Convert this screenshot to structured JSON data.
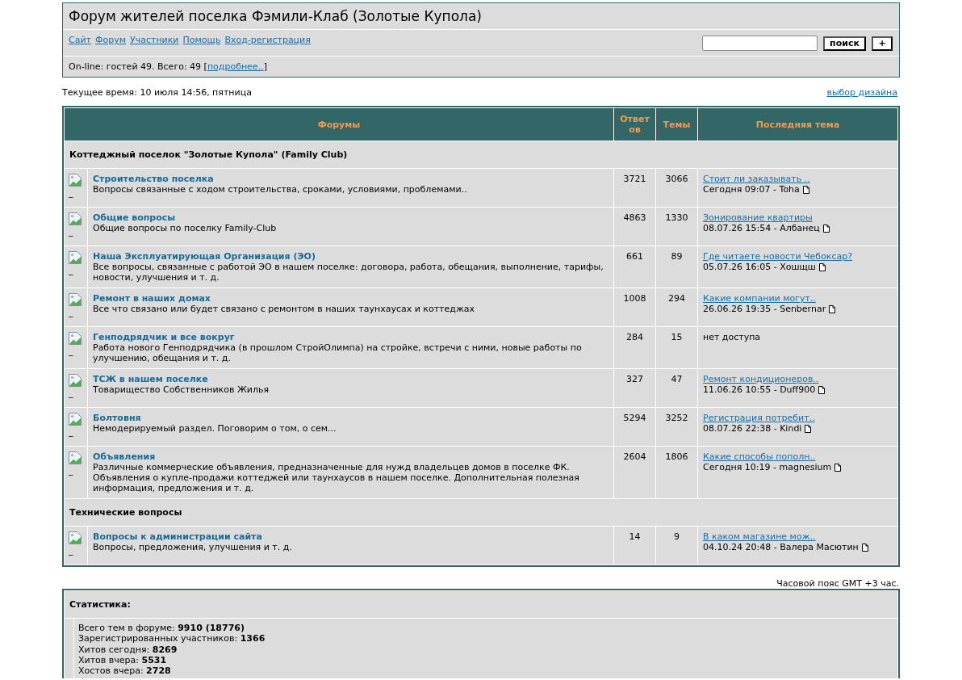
{
  "header": {
    "title": "Форум жителей поселка Фэмили-Клаб (Золотые Купола)",
    "nav_links": [
      "Сайт",
      "Форум",
      "Участники",
      "Помощь",
      "Вход-регистрация"
    ],
    "search": {
      "button": "поиск",
      "add_button": "+"
    },
    "online": {
      "text": "On-line: гостей 49. Всего: 49 [",
      "link": "подробнее..",
      "suffix": "]"
    }
  },
  "current_time": "Текущее время: 10 июля 14:56, пятница",
  "design_link": "выбор дизайна",
  "forum_table": {
    "columns": [
      "Форумы",
      "Ответов",
      "Темы",
      "Последняя тема"
    ],
    "sections": [
      {
        "title": "Коттеджный поселок \"Золотые Купола\" (Family Club)",
        "forums": [
          {
            "icon_alt": "_",
            "name": "Строительство поселка",
            "description": "Вопросы связанные с ходом строительства, сроками, условиями, проблемами..",
            "replies": "3721",
            "topics": "3066",
            "last_post": {
              "kind": "post",
              "topic": "Стоит ли заказывать ..",
              "meta": "Сегодня 09:07 - Toha"
            }
          },
          {
            "icon_alt": "_",
            "name": "Общие вопросы",
            "description": "Общие вопросы по поселку Family-Club",
            "replies": "4863",
            "topics": "1330",
            "last_post": {
              "kind": "post",
              "topic": "Зонирование квартиры",
              "meta": "08.07.26 15:54 - Албанец"
            }
          },
          {
            "icon_alt": "_",
            "name": "Наша Эксплуатирующая Организация (ЭО)",
            "description": "Все вопросы, связанные с работой ЭО в нашем поселке: договора, работа, обещания, выполнение, тарифы, новости, улучшения и т. д.",
            "replies": "661",
            "topics": "89",
            "last_post": {
              "kind": "post",
              "topic": "Где читаете новости Чебоксар?",
              "meta": "05.07.26 16:05 - Хошщш"
            }
          },
          {
            "icon_alt": "_",
            "name": "Ремонт в наших домах",
            "description": "Все что связано или будет связано с ремонтом в наших таунхаусах и коттеджах",
            "replies": "1008",
            "topics": "294",
            "last_post": {
              "kind": "post",
              "topic": "Какие компании могут..",
              "meta": "26.06.26 19:35 - Senbernar"
            }
          },
          {
            "icon_alt": "_",
            "name": "Генподрядчик и все вокруг",
            "description": "Работа нового Генподрядчика (в прошлом СтройОлимпа) на стройке, встречи с ними, новые работы по улучшению, обещания и т. д.",
            "replies": "284",
            "topics": "15",
            "last_post": {
              "kind": "no_access",
              "text": "нет доступа"
            }
          },
          {
            "icon_alt": "_",
            "name": "ТСЖ в нашем поселке",
            "description": "Товарищество Собственников Жилья",
            "replies": "327",
            "topics": "47",
            "last_post": {
              "kind": "post",
              "topic": "Ремонт кондиционеров..",
              "meta": "11.06.26 10:55 - Duff900"
            }
          },
          {
            "icon_alt": "_",
            "name": "Болтовня",
            "description": "Немодерируемый раздел. Поговорим о том, о сем...",
            "replies": "5294",
            "topics": "3252",
            "last_post": {
              "kind": "post",
              "topic": "Регистрация потребит..",
              "meta": "08.07.26 22:38 - Kindi"
            }
          },
          {
            "icon_alt": "_",
            "name": "Объявления",
            "description": "Различные коммерческие объявления, предназначенные для нужд владельцев домов в поселке ФК. Объявления о купле-продажи коттеджей или таунхаусов в нашем поселке. Дополнительная полезная информация, предложения и т. д.",
            "replies": "2604",
            "topics": "1806",
            "last_post": {
              "kind": "post",
              "topic": "Какие способы пополн..",
              "meta": "Сегодня 10:19 - magnesium"
            }
          }
        ]
      },
      {
        "title": "Технические вопросы",
        "forums": [
          {
            "icon_alt": "_",
            "name": "Вопросы к администрации сайта",
            "description": "Вопросы, предложения, улучшения и т. д.",
            "replies": "14",
            "topics": "9",
            "last_post": {
              "kind": "post",
              "topic": "В каком магазине мож..",
              "meta": "04.10.24 20:48 - Валера Масютин"
            }
          }
        ]
      }
    ]
  },
  "timezone": "Часовой пояс GMT +3 час.",
  "statistics": {
    "title": "Статистика:",
    "lines": [
      "Всего тем в форуме: **9910 (18776)**",
      "Зарегистрированных участников: **1366**",
      "Хитов сегодня: **8269**",
      "Хитов вчера: **5531**",
      "Хостов вчера: **2728**"
    ]
  }
}
